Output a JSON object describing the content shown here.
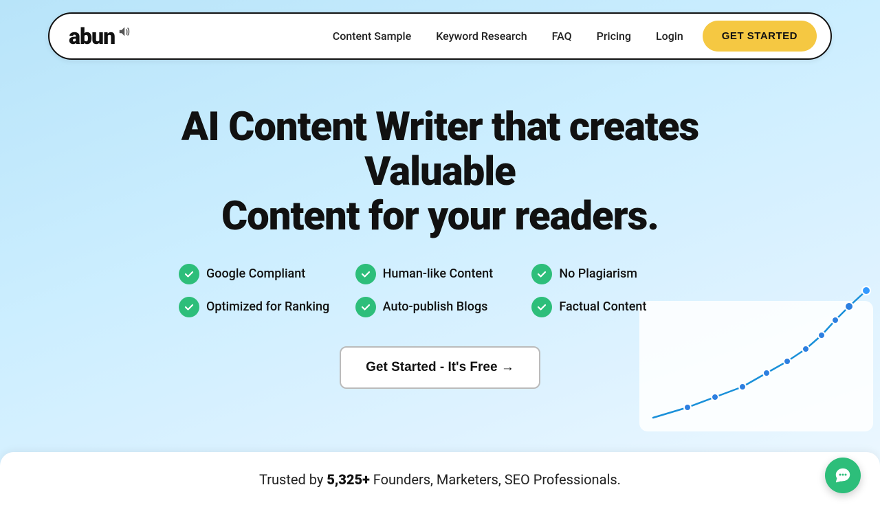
{
  "navbar": {
    "logo_text": "abun",
    "nav_links": [
      {
        "label": "Content Sample",
        "id": "content-sample"
      },
      {
        "label": "Keyword Research",
        "id": "keyword-research"
      },
      {
        "label": "FAQ",
        "id": "faq"
      },
      {
        "label": "Pricing",
        "id": "pricing"
      },
      {
        "label": "Login",
        "id": "login"
      }
    ],
    "get_started_label": "GET STARTED"
  },
  "hero": {
    "title_line1": "AI Content Writer that creates Valuable",
    "title_line2": "Content for your readers.",
    "features": [
      {
        "label": "Google Compliant"
      },
      {
        "label": "Human-like Content"
      },
      {
        "label": "No Plagiarism"
      },
      {
        "label": "Optimized for Ranking"
      },
      {
        "label": "Auto-publish Blogs"
      },
      {
        "label": "Factual Content"
      }
    ],
    "cta_label": "Get Started - It's Free →"
  },
  "bottom_bar": {
    "text_before": "Trusted by ",
    "highlight": "5,325+",
    "text_after": " Founders, Marketers, SEO Professionals."
  },
  "colors": {
    "accent_yellow": "#f5c842",
    "accent_green": "#2dbe7a",
    "background_start": "#b8e4f9",
    "background_end": "#eef8ff"
  }
}
